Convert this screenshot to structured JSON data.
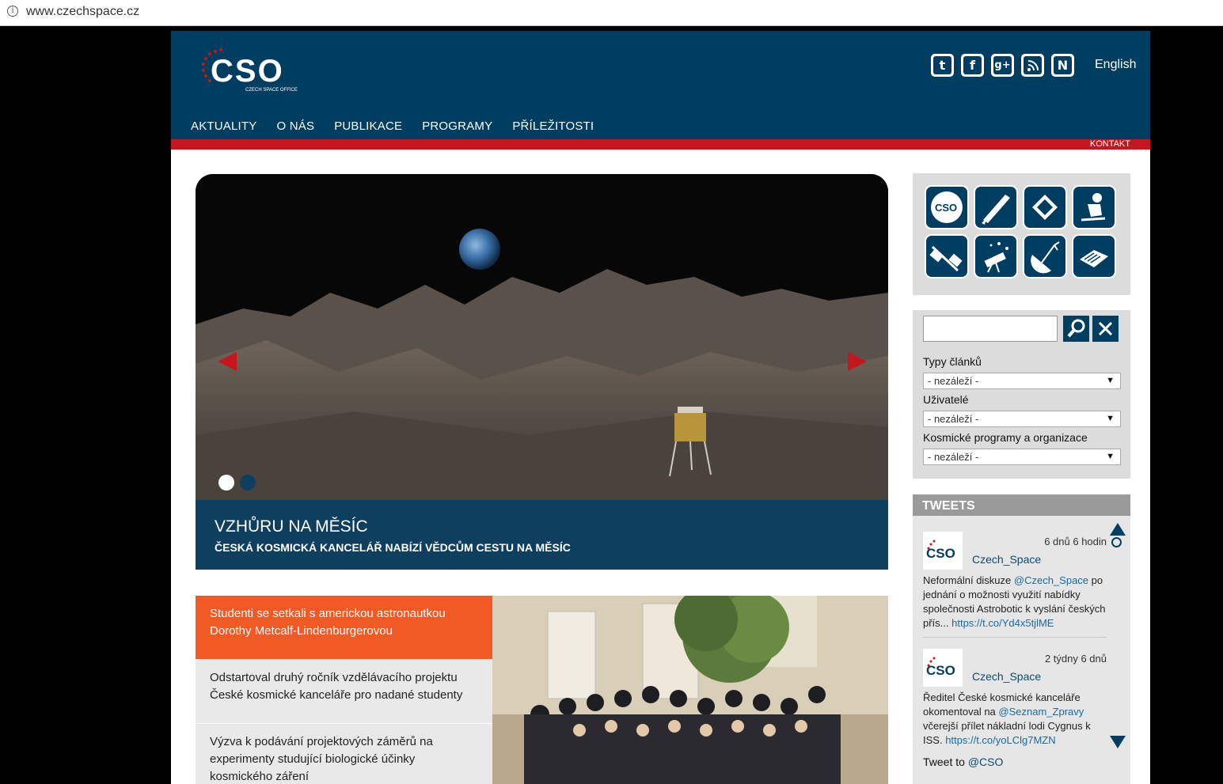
{
  "browser": {
    "url": "www.czechspace.cz",
    "info_icon": "info-icon"
  },
  "header": {
    "logo_text": "CSO",
    "logo_sub": "CZECH SPACE OFFICE",
    "social": [
      {
        "name": "twitter-icon",
        "glyph": "t"
      },
      {
        "name": "facebook-icon",
        "glyph": "f"
      },
      {
        "name": "google-plus-icon",
        "glyph": "g+"
      },
      {
        "name": "rss-icon",
        "glyph": "≋"
      },
      {
        "name": "n-icon",
        "glyph": "N"
      }
    ],
    "language": "English",
    "nav": [
      "AKTUALITY",
      "O NÁS",
      "PUBLIKACE",
      "PROGRAMY",
      "PŘÍLEŽITOSTI"
    ],
    "kontakt": "KONTAKT",
    "colors": {
      "header": "#003e61",
      "accent_red": "#c4161c",
      "orange": "#f15a24"
    }
  },
  "hero": {
    "title": "VZHŮRU NA MĚSÍC",
    "subtitle": "ČESKÁ KOSMICKÁ KANCELÁŘ NABÍZÍ VĚDCŮM CESTU NA MĚSÍC",
    "slide_count": 2,
    "active_slide": 1
  },
  "news": [
    "Studenti se setkali s americkou astronautkou Dorothy Metcalf-Lindenburgerovou",
    "Odstartoval druhý ročník vzdělávacího projektu České kosmické kanceláře pro nadané studenty",
    "Výzva k podávání projektových záměrů na experimenty studující biologické účinky kosmického záření"
  ],
  "icon_tiles": [
    "cso-icon",
    "rocket-icon",
    "chip-icon",
    "astronaut-icon",
    "satellite-icon",
    "telescope-icon",
    "antenna-icon",
    "book-icon"
  ],
  "search": {
    "placeholder": "",
    "filters": [
      {
        "label": "Typy článků",
        "value": "- nezáleží -"
      },
      {
        "label": "Uživatelé",
        "value": "- nezáleží -"
      },
      {
        "label": "Kosmické programy a organizace",
        "value": "- nezáleží -"
      }
    ]
  },
  "tweets": {
    "title": "TWEETS",
    "items": [
      {
        "time": "6 dnů 6 hodin",
        "user": "Czech_Space",
        "text_before": "Neformální diskuze ",
        "mention": "@Czech_Space",
        "text_after": " po jednání o možnosti využití nabídky společnosti Astrobotic k vyslání českých přís... ",
        "link": "https://t.co/Yd4x5tjlME"
      },
      {
        "time": "2 týdny 6 dnů",
        "user": "Czech_Space",
        "text_before": "Ředitel České kosmické kanceláře okomentoval na ",
        "mention": "@Seznam_Zpravy",
        "text_after": " včerejší přílet nákladní lodi Cygnus k ISS. ",
        "link": "https://t.co/yoLClg7MZN"
      }
    ],
    "tweet_to_label": "Tweet to",
    "tweet_to_handle": "@CSO"
  }
}
